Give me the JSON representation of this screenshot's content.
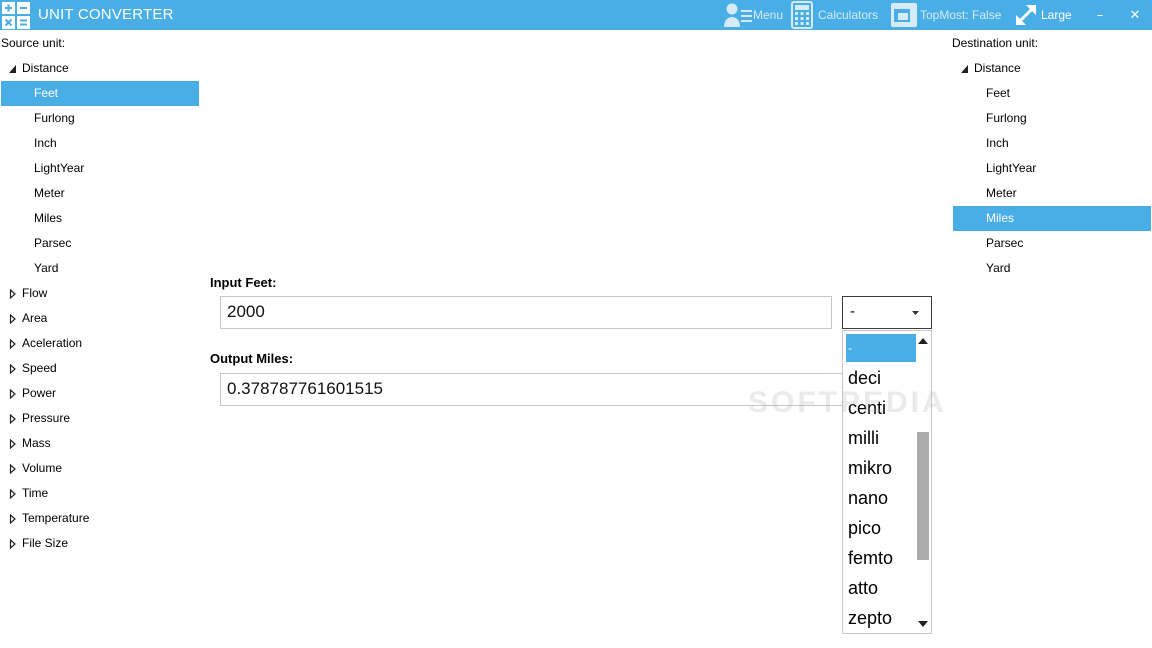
{
  "app": {
    "title": "UNIT CONVERTER",
    "accent": "#4aaee6"
  },
  "toolbar": {
    "menu_label": "Menu",
    "calculators_label": "Calculators",
    "topmost_label": "TopMost: False",
    "size_label": "Large",
    "minimize_glyph": "–",
    "close_glyph": "✕"
  },
  "source": {
    "label": "Source unit:",
    "expanded_category": "Distance",
    "units": [
      "Feet",
      "Furlong",
      "Inch",
      "LightYear",
      "Meter",
      "Miles",
      "Parsec",
      "Yard"
    ],
    "selected_unit": "Feet",
    "collapsed_categories": [
      "Flow",
      "Area",
      "Aceleration",
      "Speed",
      "Power",
      "Pressure",
      "Mass",
      "Volume",
      "Time",
      "Temperature",
      "File Size"
    ]
  },
  "destination": {
    "label": "Destination unit:",
    "expanded_category": "Distance",
    "units": [
      "Feet",
      "Furlong",
      "Inch",
      "LightYear",
      "Meter",
      "Miles",
      "Parsec",
      "Yard"
    ],
    "selected_unit": "Miles"
  },
  "form": {
    "input_label": "Input Feet:",
    "input_value": "2000",
    "output_label": "Output Miles:",
    "output_value": "0.378787761601515"
  },
  "prefix": {
    "selected": "-",
    "options": [
      "-",
      "deci",
      "centi",
      "milli",
      "mikro",
      "nano",
      "pico",
      "femto",
      "atto",
      "zepto"
    ],
    "scroll_position": 0.6
  },
  "watermark": "SOFTPEDIA"
}
